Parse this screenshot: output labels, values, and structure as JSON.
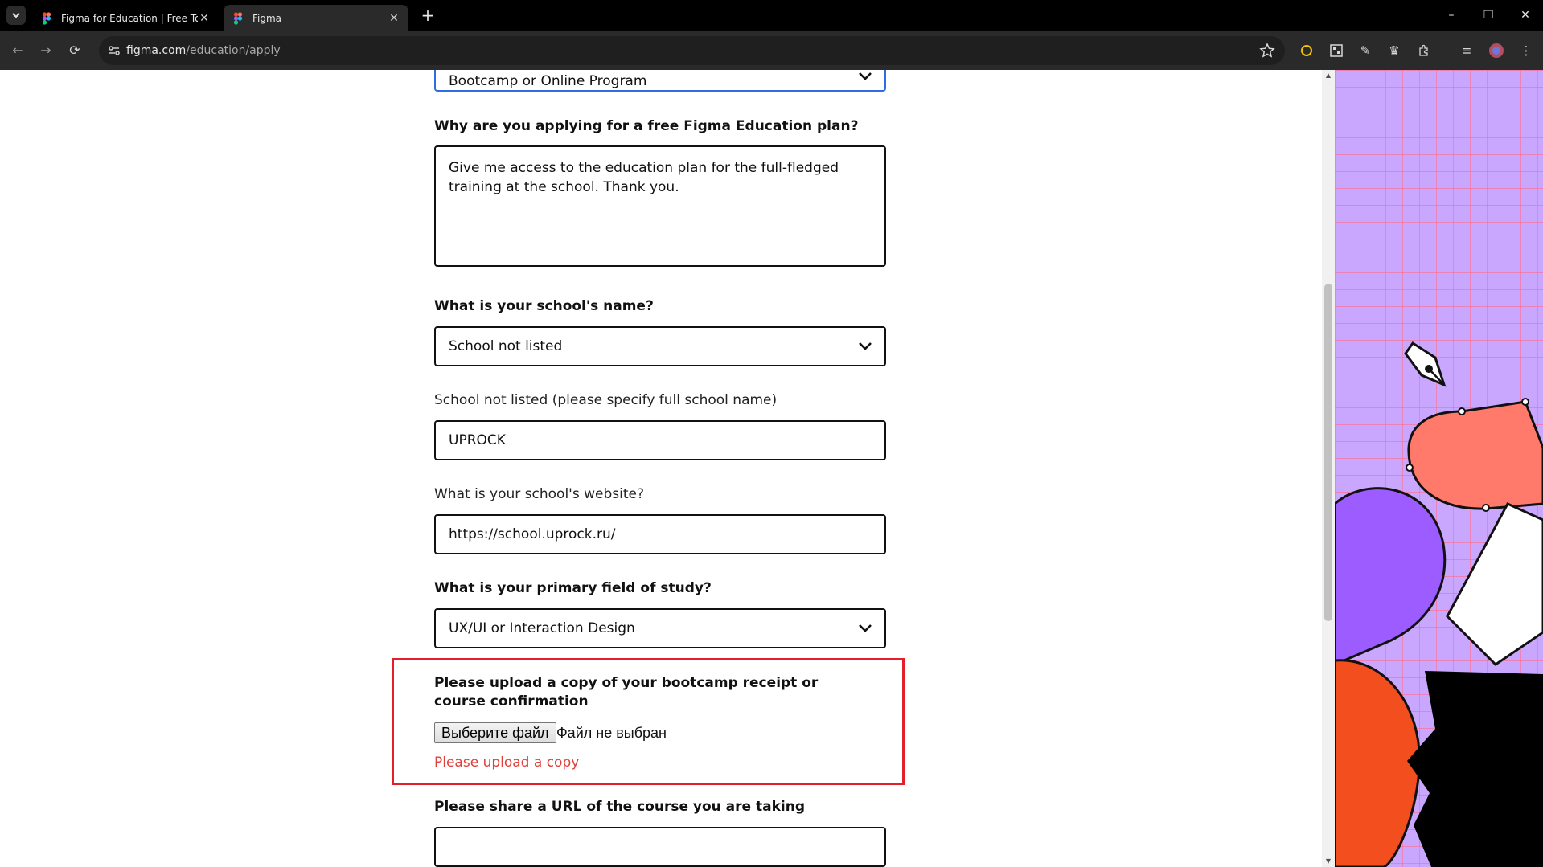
{
  "browser": {
    "tabs": [
      {
        "title": "Figma for Education | Free Tools",
        "active": false
      },
      {
        "title": "Figma",
        "active": true
      }
    ],
    "url_domain": "figma.com",
    "url_path": "/education/apply",
    "window_controls": {
      "minimize": "–",
      "restore": "❐",
      "close": "✕"
    }
  },
  "form": {
    "top_select_value": "Bootcamp or Online Program",
    "why_label": "Why are you applying for a free Figma Education plan?",
    "why_value": "Give me access to the education plan for the full-fledged training at the school. Thank you.",
    "school_label": "What is your school's name?",
    "school_value": "School not listed",
    "school_specify_label": "School not listed (please specify full school name)",
    "school_specify_value": "UPROCK",
    "website_label": "What is your school's website?",
    "website_value": "https://school.uprock.ru/",
    "field_label": "What is your primary field of study?",
    "field_value": "UX/UI or Interaction Design",
    "upload_label": "Please upload a copy of your bootcamp receipt or course confirmation",
    "file_button": "Выберите файл",
    "file_status": "Файл не выбран",
    "upload_error": "Please upload a copy",
    "course_url_label": "Please share a URL of the course you are taking",
    "course_url_value": ""
  },
  "colors": {
    "error": "#e0403a",
    "highlight_border": "#e3202a",
    "focus_border": "#2f6de0",
    "art_background": "#c9a7ff",
    "art_grid": "#ff6b8a"
  }
}
